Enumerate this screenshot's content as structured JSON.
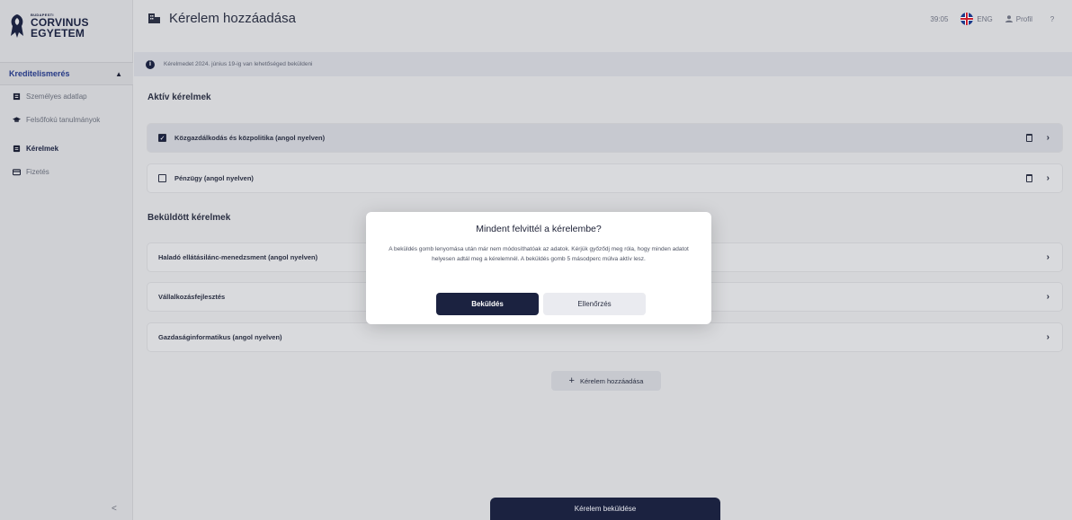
{
  "logo": {
    "small": "BUDAPESTI",
    "line1": "CORVINUS",
    "line2": "EGYETEM"
  },
  "sidebar": {
    "section_label": "Kreditelismerés",
    "items": [
      {
        "label": "Személyes adatlap",
        "icon": "id-card-icon"
      },
      {
        "label": "Felsőfokú tanulmányok",
        "icon": "graduation-cap-icon"
      },
      {
        "label": "Kérelmek",
        "icon": "document-icon",
        "active": true
      },
      {
        "label": "Fizetés",
        "icon": "credit-card-icon"
      }
    ]
  },
  "header": {
    "title": "Kérelem hozzáadása",
    "timer": "39:05",
    "lang": "ENG",
    "profile": "Profil",
    "help": "?"
  },
  "notice": {
    "text": "Kérelmedet 2024. június 19-ig van lehetőséged beküldeni"
  },
  "active_requests": {
    "title": "Aktív kérelmek",
    "items": [
      {
        "label": "Közgazdálkodás és közpolitika (angol nyelven)",
        "checked": true
      },
      {
        "label": "Pénzügy (angol nyelven)",
        "checked": false
      }
    ]
  },
  "submitted_requests": {
    "title": "Beküldött kérelmek",
    "items": [
      {
        "label": "Haladó ellátásilánc-menedzsment (angol nyelven)"
      },
      {
        "label": "Vállalkozásfejlesztés"
      },
      {
        "label": "Gazdaságinformatikus (angol nyelven)"
      }
    ]
  },
  "add_button": "Kérelem hozzáadása",
  "submit_button": "Kérelem beküldése",
  "collapse_glyph": "<",
  "modal": {
    "title": "Mindent felvittél a kérelembe?",
    "body": "A beküldés gomb lenyomása után már nem módosíthatóak az adatok. Kérjük győződj meg róla, hogy minden adatot helyesen adtál meg a kérelemnél. A beküldés gomb 5 másodperc múlva aktív lesz.",
    "primary": "Beküldés",
    "secondary": "Ellenőrzés"
  },
  "colors": {
    "navy": "#1b2240",
    "accent": "#263a86"
  }
}
